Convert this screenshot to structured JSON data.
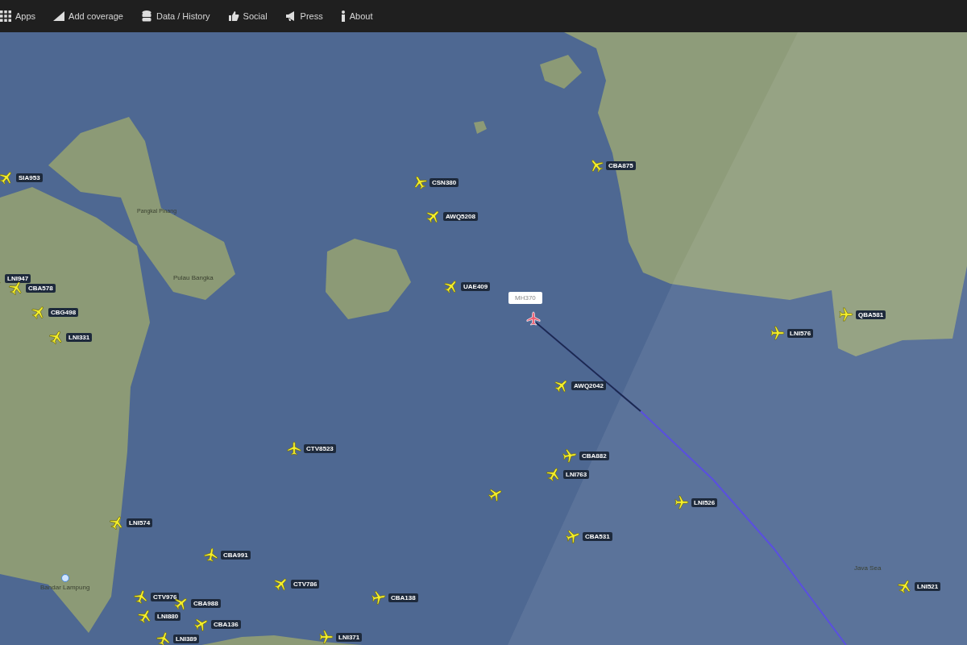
{
  "nav": [
    {
      "label": "Apps",
      "kind": "apps"
    },
    {
      "label": "Add coverage",
      "kind": "coverage"
    },
    {
      "label": "Data / History",
      "kind": "data"
    },
    {
      "label": "Social",
      "kind": "social"
    },
    {
      "label": "Press",
      "kind": "press"
    },
    {
      "label": "About",
      "kind": "about"
    }
  ],
  "places": [
    {
      "label": "Pangkal Pinang",
      "kind": "town"
    },
    {
      "label": "Pulau Bangka",
      "kind": "region"
    },
    {
      "label": "Bandar Lampung",
      "kind": "city"
    },
    {
      "label": "Java Sea",
      "kind": "region"
    }
  ],
  "flights": [
    {
      "label": "SIA953",
      "selected": false
    },
    {
      "label": "CSN380",
      "selected": false
    },
    {
      "label": "AWQ5208",
      "selected": false
    },
    {
      "label": "CBA875",
      "selected": false
    },
    {
      "label": "UAE409",
      "selected": false
    },
    {
      "label": "MH370",
      "selected": true
    },
    {
      "label": "LNI947",
      "selected": false
    },
    {
      "label": "CBA578",
      "selected": false
    },
    {
      "label": "CBG498",
      "selected": false
    },
    {
      "label": "LNI331",
      "selected": false
    },
    {
      "label": "LNI576",
      "selected": false
    },
    {
      "label": "QBA581",
      "selected": false
    },
    {
      "label": "AWQ2042",
      "selected": false
    },
    {
      "label": "CTV8523",
      "selected": false
    },
    {
      "label": "CBA882",
      "selected": false
    },
    {
      "label": "LNI763",
      "selected": false
    },
    {
      "selected": false
    },
    {
      "label": "LNI526",
      "selected": false
    },
    {
      "label": "CBA531",
      "selected": false
    },
    {
      "label": "LNI574",
      "selected": false
    },
    {
      "label": "CBA991",
      "selected": false
    },
    {
      "label": "CTV786",
      "selected": false
    },
    {
      "label": "CTV976",
      "selected": false
    },
    {
      "label": "CBA988",
      "selected": false
    },
    {
      "label": "LNI880",
      "selected": false
    },
    {
      "label": "CBA136",
      "selected": false
    },
    {
      "label": "LNI389",
      "selected": false
    },
    {
      "label": "CBA138",
      "selected": false
    },
    {
      "label": "LNI371",
      "selected": false
    },
    {
      "label": "LNI521",
      "selected": false
    }
  ]
}
